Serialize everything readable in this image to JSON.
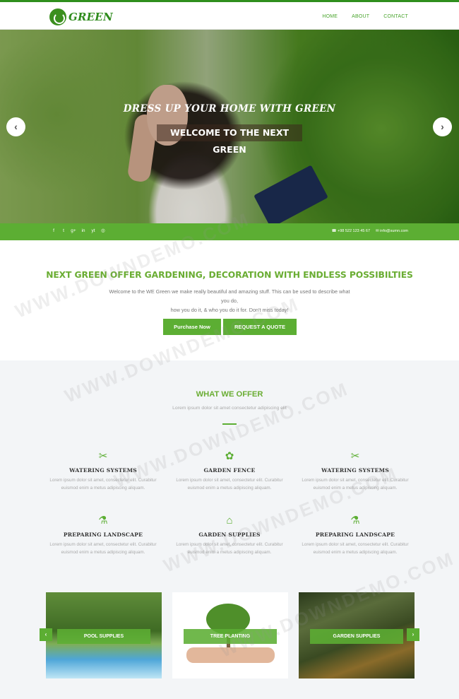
{
  "header": {
    "logo_text": "GREEN",
    "nav": [
      "HOME",
      "ABOUT",
      "CONTACT"
    ]
  },
  "hero": {
    "subtitle": "DRESS UP YOUR HOME WITH GREEN",
    "title": "WELCOME TO THE NEXT GREEN",
    "prev_icon": "chevron-left-icon",
    "next_icon": "chevron-right-icon"
  },
  "social_bar": {
    "icons": [
      "f",
      "t",
      "g+",
      "in",
      "yt",
      "◎"
    ],
    "phone": "☎ +98 522 123 45 67",
    "email": "✉ info@sumn.com"
  },
  "intro": {
    "heading": "NEXT GREEN OFFER GARDENING, DECORATION WITH ENDLESS POSSIBILTIES",
    "text_line1": "Welcome to the WE Green we make really beautiful and amazing stuff. This can be used to describe what you do,",
    "text_line2": "how you do it, & who you do it for.  Don't miss today!",
    "btn_purchase": "Purchase Now",
    "btn_quote": "REQUEST A QUOTE"
  },
  "offer": {
    "heading": "WHAT WE OFFER",
    "subheading": "Lorem ipsum dolor sit amet consectetur adipiscing elit",
    "features": [
      {
        "icon": "✂",
        "title": "WATERING SYSTEMS",
        "text": "Lorem ipsum dolor sit amet, consectetur elit. Curabitur euismod enim a metus adipiscing aliquam."
      },
      {
        "icon": "✿",
        "title": "GARDEN FENCE",
        "text": "Lorem ipsum dolor sit amet, consectetur elit. Curabitur euismod enim a metus adipiscing aliquam."
      },
      {
        "icon": "✂",
        "title": "WATERING SYSTEMS",
        "text": "Lorem ipsum dolor sit amet, consectetur elit. Curabitur euismod enim a metus adipiscing aliquam."
      },
      {
        "icon": "⚗",
        "title": "PREPARING LANDSCAPE",
        "text": "Lorem ipsum dolor sit amet, consectetur elit. Curabitur euismod enim a metus adipiscing aliquam."
      },
      {
        "icon": "⌂",
        "title": "GARDEN SUPPLIES",
        "text": "Lorem ipsum dolor sit amet, consectetur elit. Curabitur euismod enim a metus adipiscing aliquam."
      },
      {
        "icon": "⚗",
        "title": "PREPARING LANDSCAPE",
        "text": "Lorem ipsum dolor sit amet, consectetur elit. Curabitur euismod enim a metus adipiscing aliquam."
      }
    ]
  },
  "gallery": {
    "cards": [
      "POOL SUPPLIES",
      "TREE PLANTING",
      "GARDEN SUPPLIES"
    ],
    "prev_icon": "chevron-left-icon",
    "next_icon": "chevron-right-icon"
  },
  "watermark": "WWW.DOWNDEMO.COM",
  "colors": {
    "accent": "#5cae33",
    "heading_green": "#6aad33",
    "dark_green": "#2e8b1c",
    "offer_bg": "#f3f5f7"
  }
}
